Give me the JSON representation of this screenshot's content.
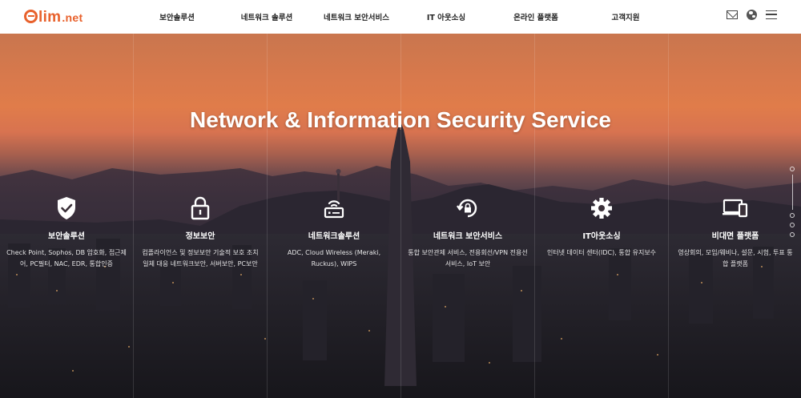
{
  "header": {
    "logo_text": "lim",
    "logo_suffix": ".net",
    "nav": [
      {
        "label": "보안솔루션"
      },
      {
        "label": "네트워크 솔루션"
      },
      {
        "label": "네트워크 보안서비스"
      },
      {
        "label": "IT 아웃소싱"
      },
      {
        "label": "온라인 플랫폼"
      },
      {
        "label": "고객지원"
      }
    ],
    "icons": [
      "mail-icon",
      "globe-icon",
      "menu-icon"
    ]
  },
  "hero": {
    "headline": "Network & Information Security Service",
    "services": [
      {
        "icon": "shield-check-icon",
        "title": "보안솔루션",
        "desc": "Check Point, Sophos, DB 암호화, 접근제어, PC필터, NAC, EDR, 통합인증"
      },
      {
        "icon": "lock-icon",
        "title": "정보보안",
        "desc": "컴플라이언스 및 정보보안 기술적 보호 조치 일체 대응 네트워크보안, 서버보안, PC보안"
      },
      {
        "icon": "router-icon",
        "title": "네트워크솔루션",
        "desc": "ADC, Cloud Wireless (Meraki, Ruckus), WIPS"
      },
      {
        "icon": "refresh-lock-icon",
        "title": "네트워크 보안서비스",
        "desc": "통합 보안관제 서비스, 전용회선/VPN 전용선 서비스, IoT 보안"
      },
      {
        "icon": "gear-icon",
        "title": "IT아웃소싱",
        "desc": "인터넷 데이터 센터(IDC), 통합 유지보수"
      },
      {
        "icon": "devices-icon",
        "title": "비대면 플랫폼",
        "desc": "영상회의, 모임/웨비나, 설문, 시험, 투표 통합 플랫폼"
      }
    ]
  },
  "colors": {
    "brand": "#e8612c",
    "header_bg": "#ffffff",
    "text_dark": "#222222",
    "sky_orange": "#e07c4a"
  }
}
